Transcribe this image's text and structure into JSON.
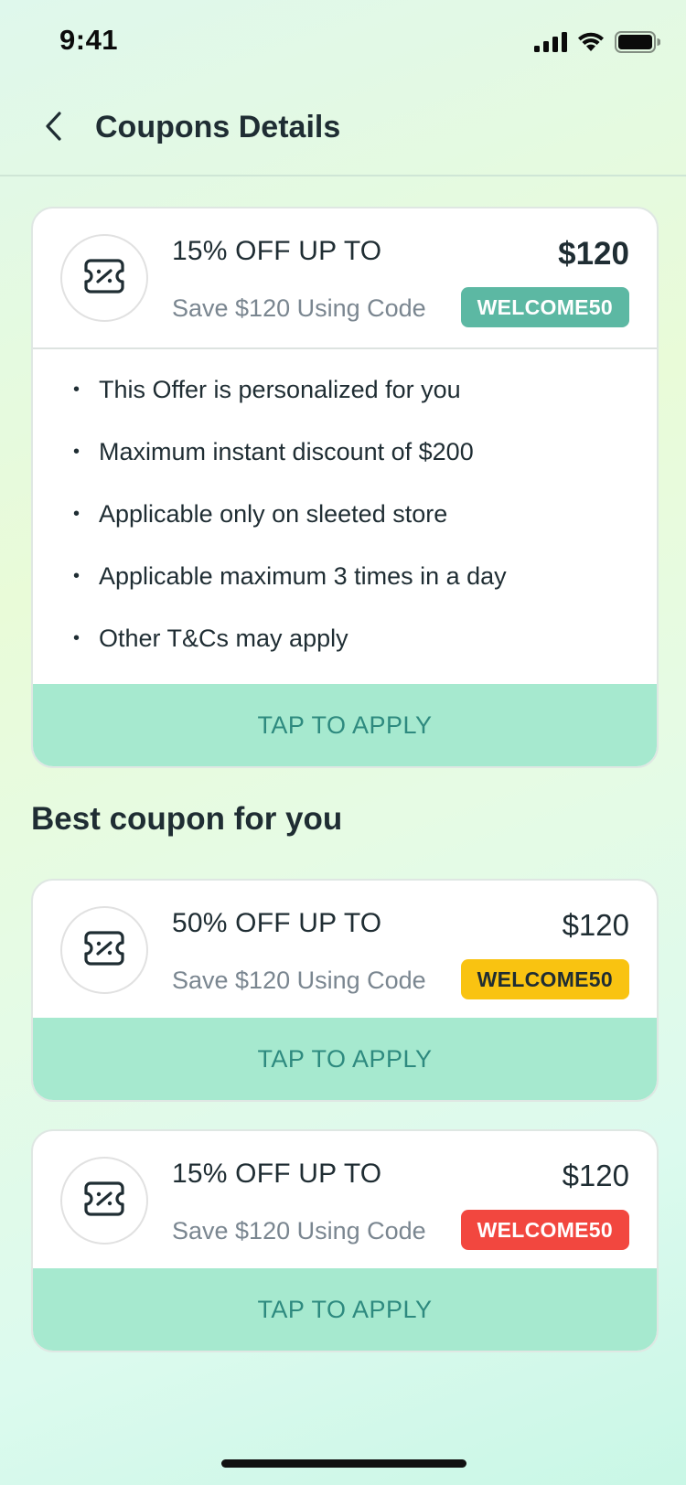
{
  "status_bar": {
    "time": "9:41"
  },
  "header": {
    "title": "Coupons Details"
  },
  "featured_coupon": {
    "title": "15% OFF UP TO",
    "amount": "$120",
    "subtitle": "Save $120 Using Code",
    "code": "WELCOME50",
    "code_color": "#5cb8a3",
    "terms": [
      "This Offer is personalized for you",
      "Maximum instant discount of $200",
      "Applicable only on sleeted store",
      "Applicable maximum 3 times in a day",
      "Other T&Cs may apply"
    ],
    "apply_label": "TAP TO APPLY"
  },
  "section": {
    "title": "Best coupon for you"
  },
  "coupons": [
    {
      "title": "50% OFF UP TO",
      "amount": "$120",
      "subtitle": "Save $120 Using Code",
      "code": "WELCOME50",
      "code_color": "#f9c311",
      "apply_label": "TAP TO APPLY"
    },
    {
      "title": "15% OFF UP TO",
      "amount": "$120",
      "subtitle": "Save $120 Using Code",
      "code": "WELCOME50",
      "code_color": "#f2473f",
      "apply_label": "TAP TO APPLY"
    }
  ],
  "icons": {
    "back": "chevron-left-icon",
    "coupon": "discount-ticket-icon",
    "signal": "cellular-signal-icon",
    "wifi": "wifi-icon",
    "battery": "battery-icon"
  },
  "colors": {
    "apply_background": "#a6e9cf",
    "apply_text": "#2e8a7f",
    "text_primary": "#1f2d33",
    "text_secondary": "#7a8690"
  }
}
